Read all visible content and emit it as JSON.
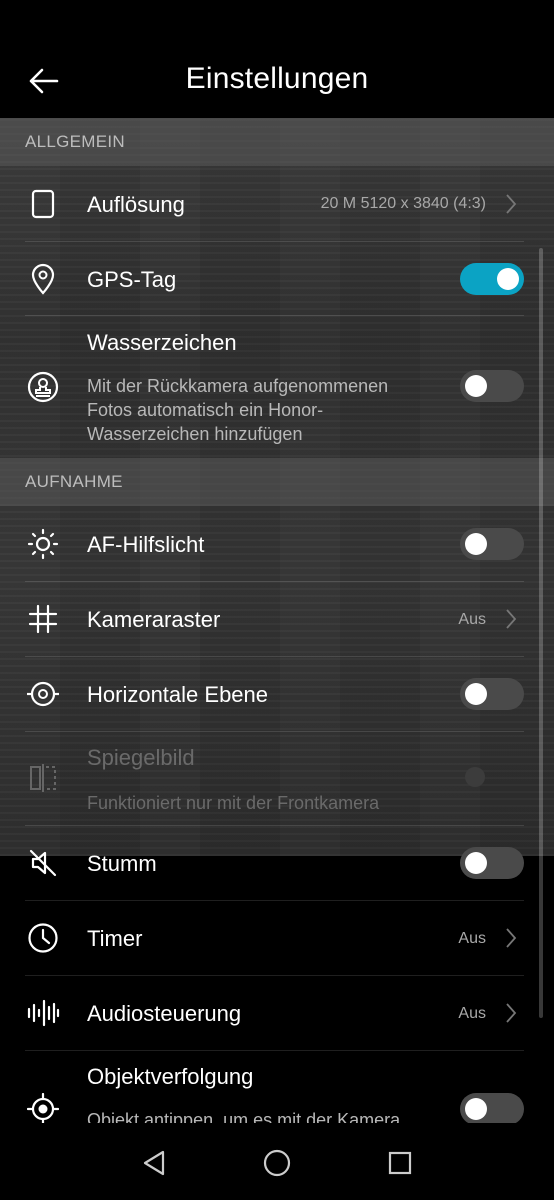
{
  "header": {
    "title": "Einstellungen"
  },
  "sections": {
    "general": "ALLGEMEIN",
    "capture": "AUFNAHME"
  },
  "settings": {
    "resolution": {
      "label": "Auflösung",
      "value": "20 M 5120 x 3840 (4:3)"
    },
    "gps_tag": {
      "label": "GPS-Tag",
      "enabled": true
    },
    "watermark": {
      "label": "Wasserzeichen",
      "desc": "Mit der Rückkamera aufgenommenen Fotos automatisch ein Honor-Wasserzeichen hinzufügen",
      "enabled": false
    },
    "af_light": {
      "label": "AF-Hilfslicht",
      "enabled": false
    },
    "grid": {
      "label": "Kameraraster",
      "value": "Aus"
    },
    "level": {
      "label": "Horizontale Ebene",
      "enabled": false
    },
    "mirror": {
      "label": "Spiegelbild",
      "desc": "Funktioniert nur mit der Frontkamera",
      "enabled": false,
      "disabled": true
    },
    "mute": {
      "label": "Stumm",
      "enabled": false
    },
    "timer": {
      "label": "Timer",
      "value": "Aus"
    },
    "audio_control": {
      "label": "Audiosteuerung",
      "value": "Aus"
    },
    "tracking": {
      "label": "Objektverfolgung",
      "desc": "Objekt antippen, um es mit der Kamera",
      "enabled": false
    }
  },
  "colors": {
    "accent": "#0ba3c4",
    "background": "#000000"
  },
  "icons": {
    "back": "arrow-left-icon",
    "resolution": "phone-icon",
    "gps": "location-pin-icon",
    "watermark": "stamp-icon",
    "af": "sun-icon",
    "grid": "grid-icon",
    "level": "level-icon",
    "mirror": "mirror-icon",
    "mute": "mute-icon",
    "timer": "clock-icon",
    "audio": "waveform-icon",
    "tracking": "target-icon"
  }
}
